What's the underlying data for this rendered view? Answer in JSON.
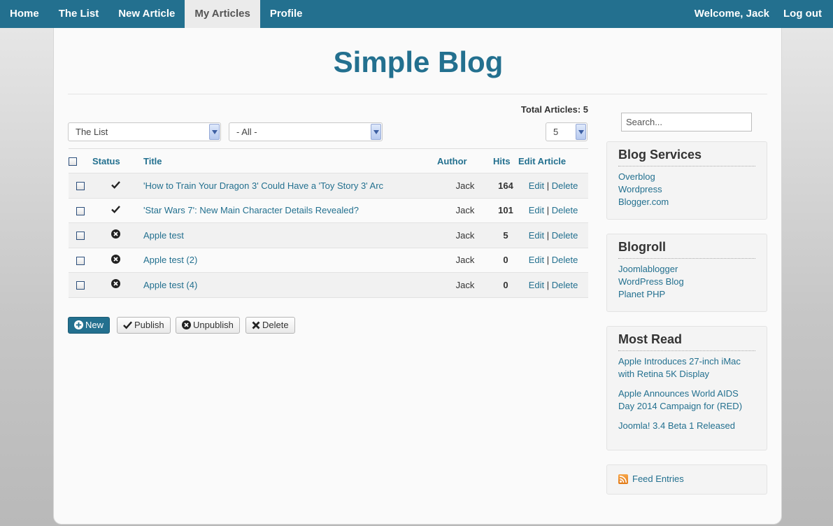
{
  "nav": {
    "left": [
      {
        "label": "Home",
        "active": false
      },
      {
        "label": "The List",
        "active": false
      },
      {
        "label": "New Article",
        "active": false
      },
      {
        "label": "My Articles",
        "active": true
      },
      {
        "label": "Profile",
        "active": false
      }
    ],
    "welcome": "Welcome, Jack",
    "logout": "Log out"
  },
  "site_title": "Simple Blog",
  "total_articles": "Total Articles: 5",
  "filters": {
    "category": "The List",
    "state": "- All -",
    "limit": "5"
  },
  "table": {
    "headers": {
      "status": "Status",
      "title": "Title",
      "author": "Author",
      "hits": "Hits",
      "edit": "Edit Article"
    },
    "rows": [
      {
        "status": "published",
        "status_icon": "check-icon",
        "title": "'How to Train Your Dragon 3' Could Have a 'Toy Story 3' Arc",
        "author": "Jack",
        "hits": "164",
        "edit": "Edit",
        "delete": "Delete"
      },
      {
        "status": "published",
        "status_icon": "check-icon",
        "title": "'Star Wars 7': New Main Character Details Revealed?",
        "author": "Jack",
        "hits": "101",
        "edit": "Edit",
        "delete": "Delete"
      },
      {
        "status": "unpublished",
        "status_icon": "circle-x-icon",
        "title": "Apple test",
        "author": "Jack",
        "hits": "5",
        "edit": "Edit",
        "delete": "Delete"
      },
      {
        "status": "unpublished",
        "status_icon": "circle-x-icon",
        "title": "Apple test (2)",
        "author": "Jack",
        "hits": "0",
        "edit": "Edit",
        "delete": "Delete"
      },
      {
        "status": "unpublished",
        "status_icon": "circle-x-icon",
        "title": "Apple test (4)",
        "author": "Jack",
        "hits": "0",
        "edit": "Edit",
        "delete": "Delete"
      }
    ]
  },
  "actions": {
    "new": "New",
    "publish": "Publish",
    "unpublish": "Unpublish",
    "delete": "Delete"
  },
  "sidebar": {
    "search_placeholder": "Search...",
    "blog_services": {
      "title": "Blog Services",
      "links": [
        "Overblog",
        "Wordpress",
        "Blogger.com"
      ]
    },
    "blogroll": {
      "title": "Blogroll",
      "links": [
        "Joomlablogger",
        "WordPress Blog",
        "Planet PHP"
      ]
    },
    "most_read": {
      "title": "Most Read",
      "links": [
        "Apple Introduces 27-inch iMac with Retina 5K Display",
        "Apple Announces World AIDS Day 2014 Campaign for (RED)",
        "Joomla! 3.4 Beta 1 Released"
      ]
    },
    "feed": "Feed Entries"
  },
  "colors": {
    "brand": "#23708f",
    "active_tab_bg": "#ebebeb"
  }
}
